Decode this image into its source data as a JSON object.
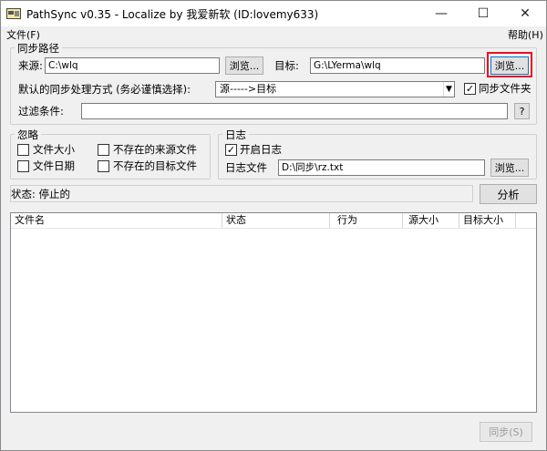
{
  "window": {
    "title": "PathSync v0.35  - Localize by 我爱新软  (ID:lovemy633)",
    "minimize": "—",
    "maximize": "☐",
    "close": "✕"
  },
  "menu": {
    "file": "文件(F)",
    "help": "帮助(H)"
  },
  "paths": {
    "group_label": "同步路径",
    "source_label": "来源:",
    "source_value": "C:\\wlq",
    "browse_source": "浏览...",
    "target_label": "目标:",
    "target_value": "G:\\LYerma\\wlq",
    "browse_target": "浏览...",
    "mode_label": "默认的同步处理方式 (务必谨慎选择):",
    "mode_value": "源----->目标",
    "sync_folder_label": "同步文件夹",
    "sync_folder_checked": true,
    "filter_label": "过滤条件:",
    "filter_value": "",
    "filter_help": "?"
  },
  "ignore": {
    "group_label": "忽略",
    "file_size": "文件大小",
    "file_date": "文件日期",
    "missing_source": "不存在的来源文件",
    "missing_target": "不存在的目标文件"
  },
  "log": {
    "group_label": "日志",
    "enable_label": "开启日志",
    "enable_checked": true,
    "file_label": "日志文件",
    "file_value": "D:\\同步\\rz.txt",
    "browse": "浏览..."
  },
  "status": {
    "text": "状态: 停止的",
    "analyze_button": "分析"
  },
  "table": {
    "columns": [
      "文件名",
      "状态",
      "行为",
      "源大小",
      "目标大小"
    ],
    "rows": []
  },
  "footer": {
    "sync_button": "同步(S)"
  },
  "colors": {
    "highlight": "#e81123",
    "focus": "#0078d7"
  }
}
